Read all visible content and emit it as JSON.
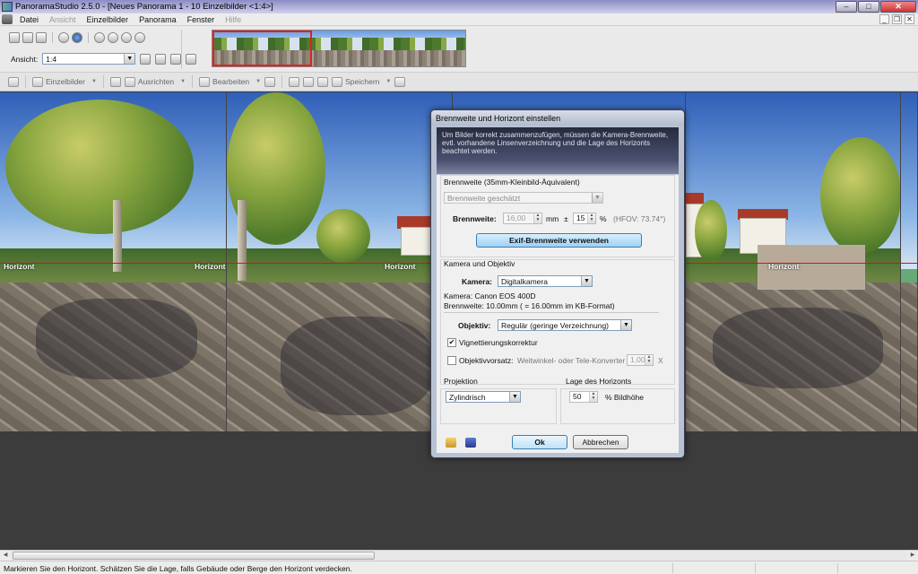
{
  "window": {
    "title": "PanoramaStudio 2.5.0 - [Neues Panorama 1 - 10 Einzelbilder <1:4>]",
    "min": "–",
    "max": "□",
    "close": "✕"
  },
  "menu": {
    "items": [
      {
        "label": "Datei",
        "enabled": true
      },
      {
        "label": "Ansicht",
        "enabled": false
      },
      {
        "label": "Einzelbilder",
        "enabled": true
      },
      {
        "label": "Panorama",
        "enabled": true
      },
      {
        "label": "Fenster",
        "enabled": true
      },
      {
        "label": "Hilfe",
        "enabled": false
      }
    ],
    "mdi_min": "_",
    "mdi_restore": "❐",
    "mdi_close": "✕"
  },
  "toolbar1": {
    "ansicht_label": "Ansicht:",
    "ansicht_value": "1:4"
  },
  "toolbar2": {
    "einzelbilder": "Einzelbilder",
    "ausrichten": "Ausrichten",
    "bearbeiten": "Bearbeiten",
    "speichern": "Speichern"
  },
  "canvas": {
    "horizon_label": "Horizont"
  },
  "dialog": {
    "title": "Brennweite und Horizont einstellen",
    "info": "Um Bilder korrekt zusammenzufügen, müssen die Kamera-Brennweite, evtl. vorhandene Linsenverzeichnung und die Lage des Horizonts beachtet werden.",
    "focal": {
      "group": "Brennweite (35mm-Kleinbild-Äquivalent)",
      "mode": "Brennweite geschätzt",
      "label": "Brennweite:",
      "value": "16,00",
      "unit": "mm",
      "pm": "±",
      "tolerance": "15",
      "percent": "%",
      "hfov": "(HFOV: 73.74°)",
      "exif_button": "Exif-Brennweite verwenden"
    },
    "camera": {
      "group": "Kamera und Objektiv",
      "label": "Kamera:",
      "value": "Digitalkamera",
      "model": "Kamera: Canon EOS 400D",
      "focal_info": "Brennweite: 10.00mm ( = 16.00mm im KB-Format)",
      "lens_label": "Objektiv:",
      "lens_value": "Regulär  (geringe Verzeichnung)",
      "vignette_label": "Vignettierungskorrektur",
      "vignette_checked": true,
      "adapter_label": "Objektivvorsatz:",
      "adapter_checked": false,
      "adapter_desc": "Weitwinkel- oder Tele-Konverter",
      "adapter_value": "1,00",
      "adapter_unit": "X"
    },
    "projection": {
      "group": "Projektion",
      "value": "Zylindrisch"
    },
    "horizon": {
      "group": "Lage des Horizonts",
      "value": "50",
      "unit": "% Bildhöhe"
    },
    "ok": "Ok",
    "cancel": "Abbrechen"
  },
  "statusbar": {
    "text": "Markieren Sie den Horizont. Schätzen Sie die Lage, falls Gebäude oder Berge den Horizont verdecken."
  }
}
